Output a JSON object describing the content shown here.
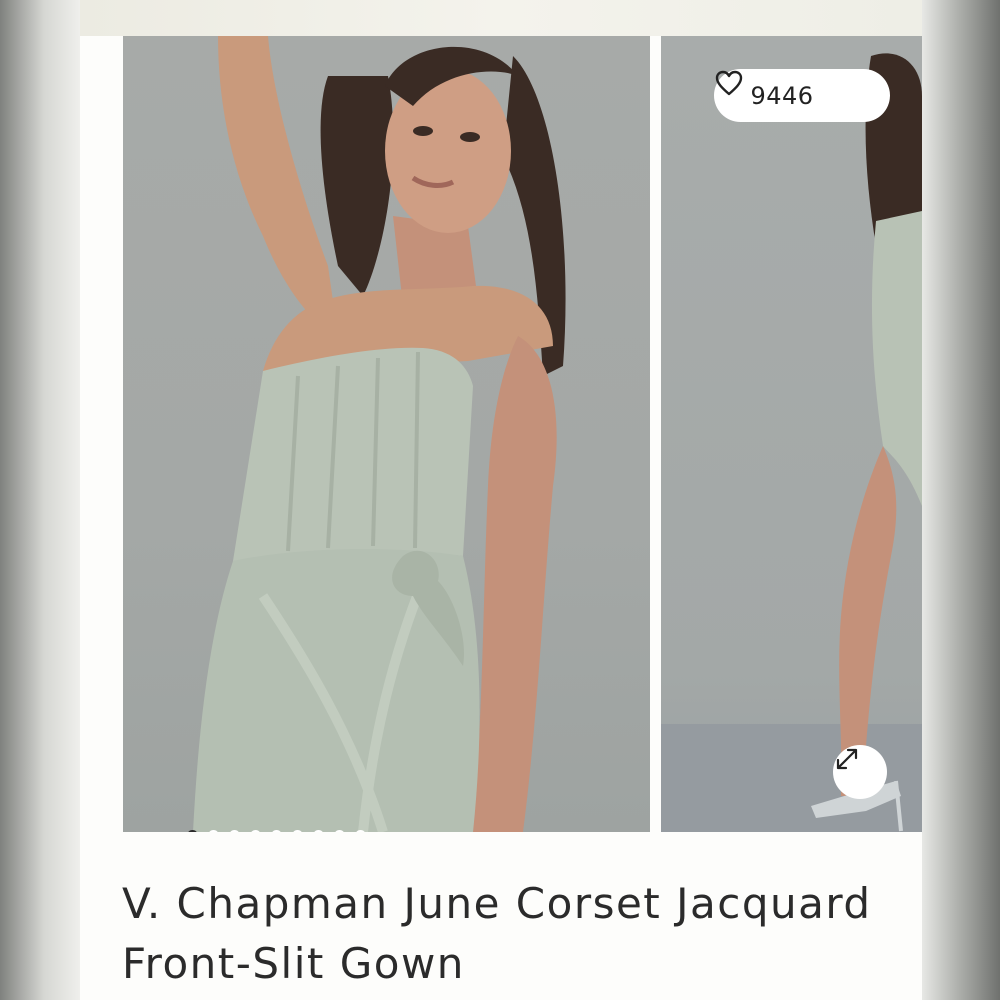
{
  "product": {
    "title": "V. Chapman June Corset Jacquard Front-Slit Gown",
    "like_count": "9446"
  },
  "gallery": {
    "image_count": 9,
    "active_index": 0,
    "images": [
      {
        "alt": "Model wearing sage satin strapless corset gown, arm raised"
      },
      {
        "alt": "Model wearing sage satin gown with front slit and silver heels"
      }
    ]
  },
  "icons": {
    "like": "heart-outline-icon",
    "expand": "expand-arrows-icon"
  },
  "colors": {
    "dress": "#b7c1b5",
    "backdrop": "#a5a9a7",
    "text": "#2b2b2b",
    "active_dot": "#2a2a2a"
  }
}
